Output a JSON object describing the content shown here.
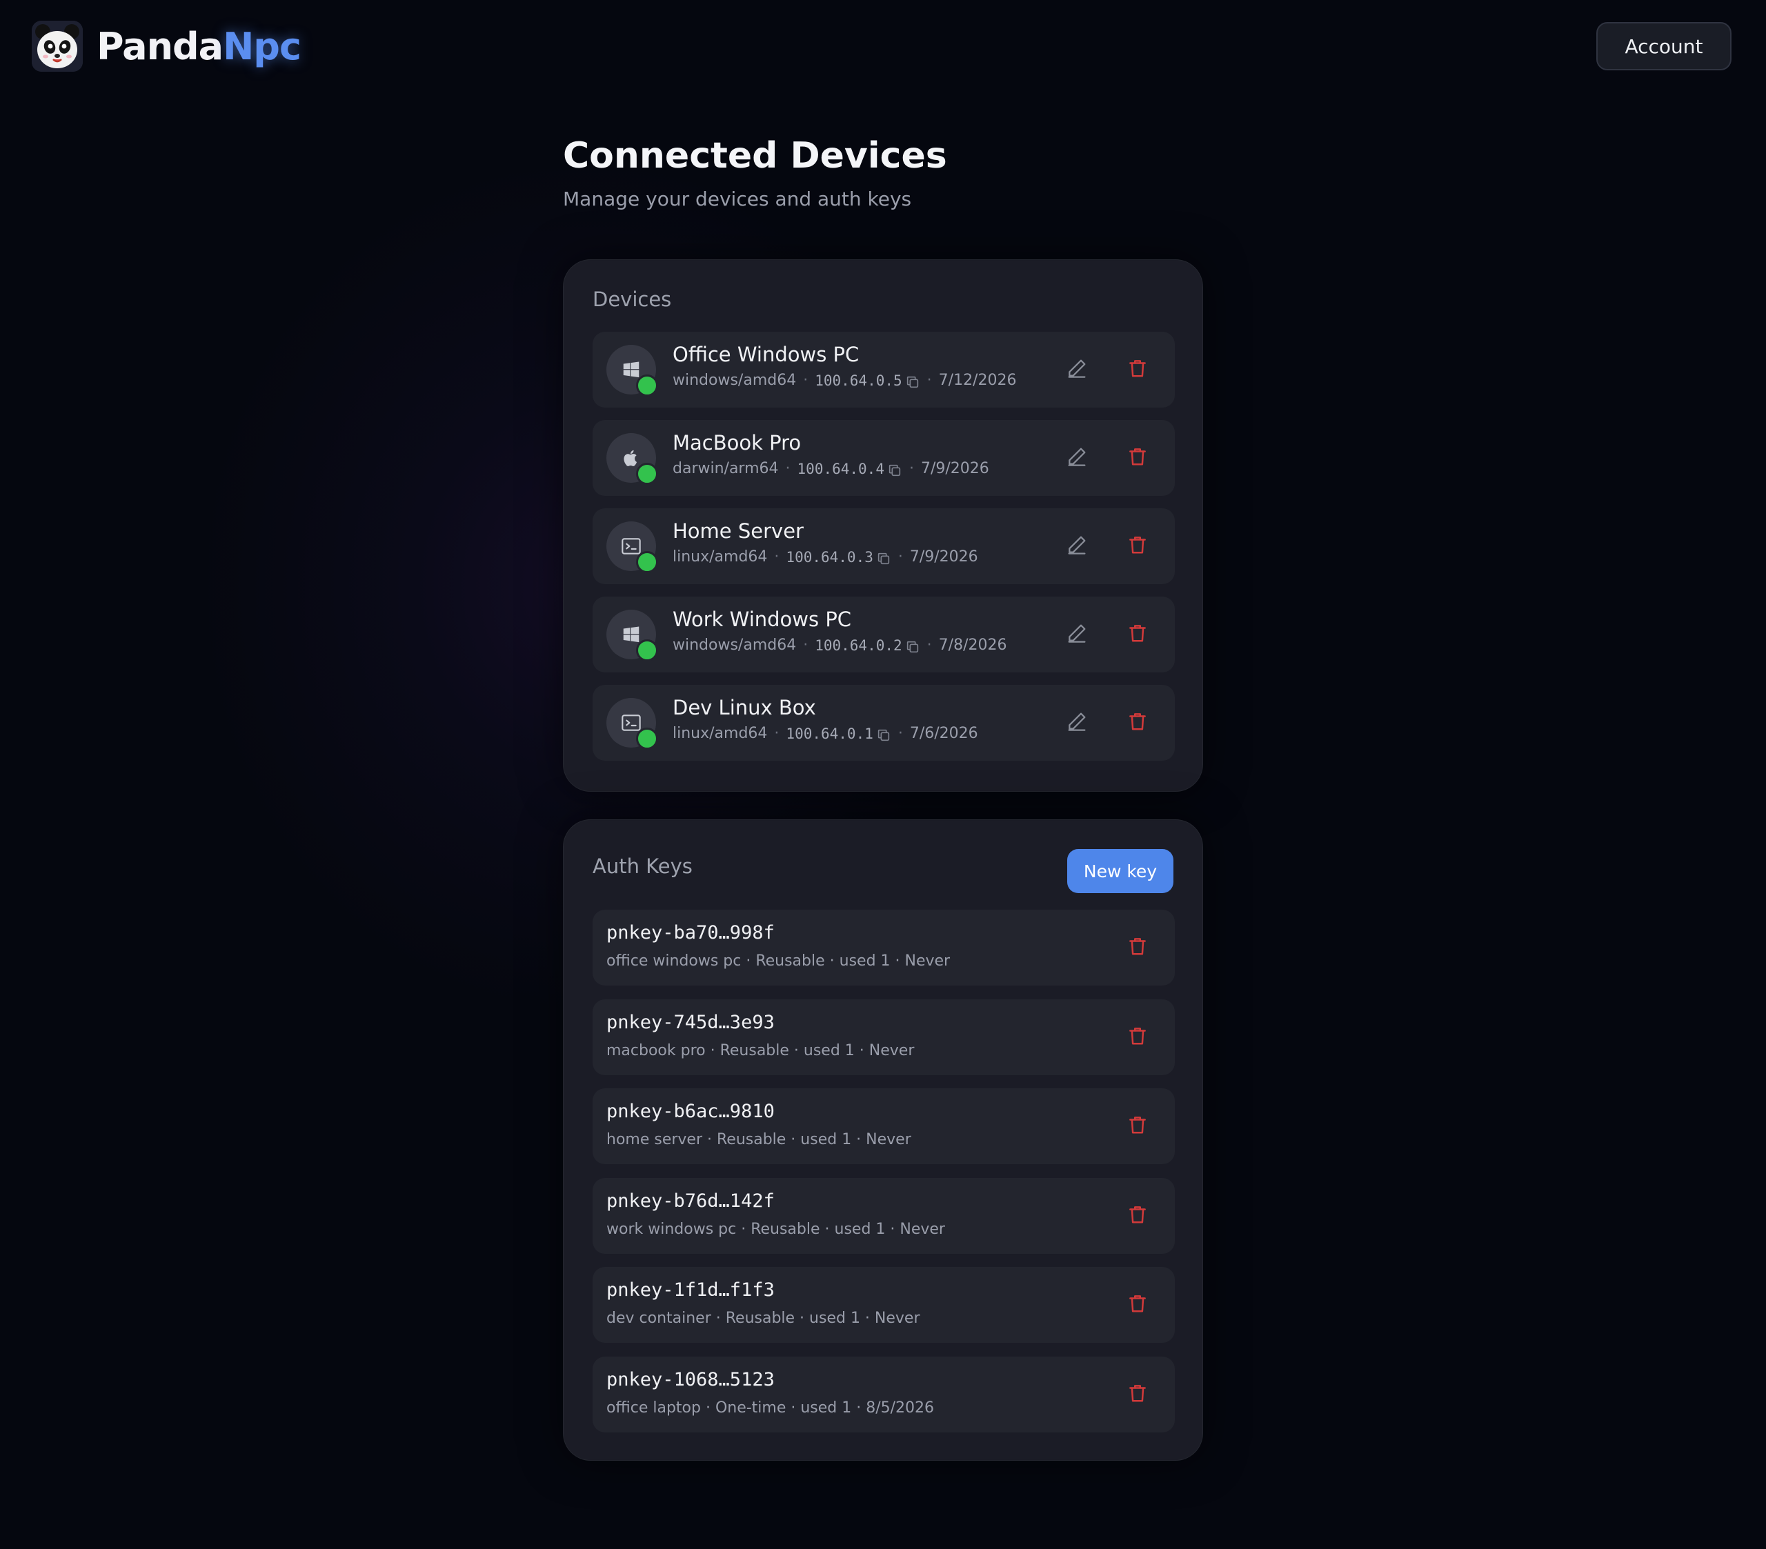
{
  "brand": {
    "name_part1": "Panda",
    "name_part2": "Npc",
    "accent_color": "#5b8ef0"
  },
  "header": {
    "account_label": "Account"
  },
  "page": {
    "title": "Connected Devices",
    "subtitle": "Manage your devices and auth keys"
  },
  "devices": {
    "title": "Devices",
    "items": [
      {
        "name": "Office Windows PC",
        "platform": "windows/amd64",
        "ip": "100.64.0.5",
        "date": "7/12/2026",
        "icon": "windows-icon",
        "status": "online"
      },
      {
        "name": "MacBook Pro",
        "platform": "darwin/arm64",
        "ip": "100.64.0.4",
        "date": "7/9/2026",
        "icon": "apple-icon",
        "status": "online"
      },
      {
        "name": "Home Server",
        "platform": "linux/amd64",
        "ip": "100.64.0.3",
        "date": "7/9/2026",
        "icon": "terminal-icon",
        "status": "online"
      },
      {
        "name": "Work Windows PC",
        "platform": "windows/amd64",
        "ip": "100.64.0.2",
        "date": "7/8/2026",
        "icon": "windows-icon",
        "status": "online"
      },
      {
        "name": "Dev Linux Box",
        "platform": "linux/amd64",
        "ip": "100.64.0.1",
        "date": "7/6/2026",
        "icon": "terminal-icon",
        "status": "online"
      }
    ],
    "status_color": "#33c24d"
  },
  "auth_keys": {
    "title": "Auth Keys",
    "new_key_label": "New key",
    "items": [
      {
        "key": "pnkey-ba70…998f",
        "meta": "office windows pc · Reusable · used 1 · Never"
      },
      {
        "key": "pnkey-745d…3e93",
        "meta": "macbook pro · Reusable · used 1 · Never"
      },
      {
        "key": "pnkey-b6ac…9810",
        "meta": "home server · Reusable · used 1 · Never"
      },
      {
        "key": "pnkey-b76d…142f",
        "meta": "work windows pc · Reusable · used 1 · Never"
      },
      {
        "key": "pnkey-1f1d…f1f3",
        "meta": "dev container · Reusable · used 1 · Never"
      },
      {
        "key": "pnkey-1068…5123",
        "meta": "office laptop · One-time · used 1 · 8/5/2026"
      }
    ],
    "delete_color": "#d23a3a",
    "button_color": "#4e86ea"
  }
}
